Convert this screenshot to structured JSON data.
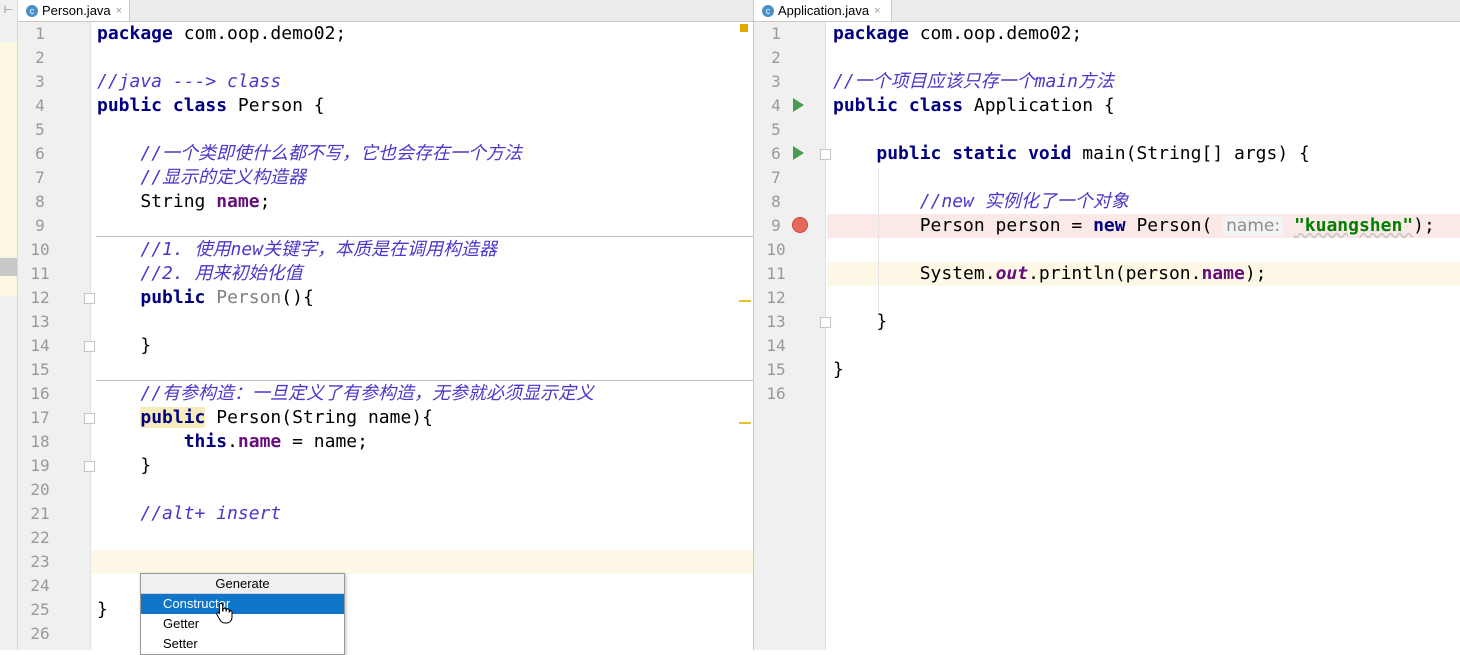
{
  "left_editor": {
    "tab": {
      "icon": "class-icon",
      "icon_letter": "c",
      "title": "Person.java",
      "close": "×"
    },
    "lines": [
      {
        "n": "1",
        "html": "<span class='kw'>package</span> com.oop.demo02;"
      },
      {
        "n": "2",
        "html": ""
      },
      {
        "n": "3",
        "html": "<span class='cm'>//java ---> class</span>"
      },
      {
        "n": "4",
        "html": "<span class='kw'>public class</span> Person {"
      },
      {
        "n": "5",
        "html": ""
      },
      {
        "n": "6",
        "html": "    <span class='cm'>//一个类即使什么都不写，它也会存在一个方法</span>"
      },
      {
        "n": "7",
        "html": "    <span class='cm'>//显示的定义构造器</span>"
      },
      {
        "n": "8",
        "html": "    String <span class='fld'>name</span>;"
      },
      {
        "n": "9",
        "html": ""
      },
      {
        "n": "10",
        "html": "    <span class='cm'>//1. 使用new关键字，本质是在调用构造器</span>"
      },
      {
        "n": "11",
        "html": "    <span class='cm'>//2. 用来初始化值</span>"
      },
      {
        "n": "12",
        "html": "    <span class='kw'>public</span> <span class='gray'>Person</span>(){"
      },
      {
        "n": "13",
        "html": ""
      },
      {
        "n": "14",
        "html": "    }"
      },
      {
        "n": "15",
        "html": ""
      },
      {
        "n": "16",
        "html": "    <span class='cm'>//有参构造：一旦定义了有参构造，无参就必须显示定义</span>"
      },
      {
        "n": "17",
        "html": "    <span class='kw kwhl'>public</span> Person(String name){"
      },
      {
        "n": "18",
        "html": "        <span class='kw'>this</span>.<span class='fld'>name</span> = name;"
      },
      {
        "n": "19",
        "html": "    }"
      },
      {
        "n": "20",
        "html": ""
      },
      {
        "n": "21",
        "html": "    <span class='cm'>//alt+ insert</span>"
      },
      {
        "n": "22",
        "html": ""
      },
      {
        "n": "23",
        "html": ""
      },
      {
        "n": "24",
        "html": ""
      },
      {
        "n": "25",
        "html": "}"
      },
      {
        "n": "26",
        "html": ""
      }
    ]
  },
  "right_editor": {
    "tab": {
      "icon": "class-icon",
      "icon_letter": "c",
      "title": "Application.java",
      "close": "×"
    },
    "lines": [
      {
        "n": "1",
        "html": "<span class='kw'>package</span> com.oop.demo02;"
      },
      {
        "n": "2",
        "html": ""
      },
      {
        "n": "3",
        "html": "<span class='cm'>//一个项目应该只存一个main方法</span>"
      },
      {
        "n": "4",
        "html": "<span class='kw'>public class</span> Application {"
      },
      {
        "n": "5",
        "html": ""
      },
      {
        "n": "6",
        "html": "    <span class='kw'>public static void</span> main(String[] args) {"
      },
      {
        "n": "7",
        "html": ""
      },
      {
        "n": "8",
        "html": "        <span class='cm'>//new 实例化了一个对象</span>"
      },
      {
        "n": "9",
        "html": "        Person person = <span class='kw'>new</span> Person( <span class='hint'>name:</span> <span class='str'>\"kuangshen\"</span>);"
      },
      {
        "n": "10",
        "html": ""
      },
      {
        "n": "11",
        "html": "        System.<span class='static'>out</span>.println(person.<span class='fld'>name</span>);"
      },
      {
        "n": "12",
        "html": ""
      },
      {
        "n": "13",
        "html": "    }"
      },
      {
        "n": "14",
        "html": ""
      },
      {
        "n": "15",
        "html": "}"
      },
      {
        "n": "16",
        "html": ""
      }
    ]
  },
  "generate_popup": {
    "title": "Generate",
    "items": [
      "Constructor",
      "Getter",
      "Setter"
    ],
    "selected": "Constructor"
  },
  "colors": {
    "keyword": "#000080",
    "comment": "#4a38c8",
    "field": "#660e7a",
    "string": "#008000",
    "current_line": "#fdf8e6",
    "breakpoint_line": "#fbe9e7",
    "popup_selection": "#0f75c9"
  }
}
